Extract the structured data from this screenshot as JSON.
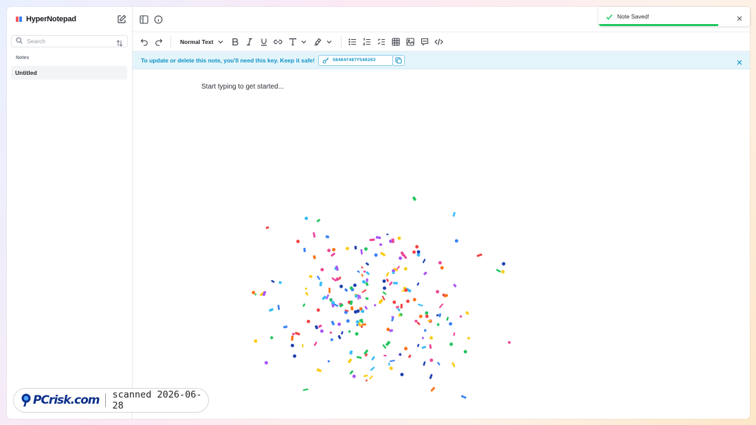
{
  "sidebar": {
    "brand": "HyperNotepad",
    "search_placeholder": "Search",
    "section_label": "Notes",
    "notes": [
      {
        "title": "Untitled"
      }
    ]
  },
  "toolbar": {
    "block_type": "Normal Text"
  },
  "banner": {
    "message": "To update or delete this note, you'll need this key. Keep it safe!",
    "key": "58484f487f548263"
  },
  "editor": {
    "placeholder": "Start typing to get started..."
  },
  "toast": {
    "message": "Note Saved!",
    "progress": 0.79
  },
  "watermark": {
    "brand": "PCrisk.com",
    "scan_text": "scanned 2026-06-28"
  },
  "colors": {
    "accent": "#0d94c6",
    "success": "#22c55e",
    "banner_bg": "#e4f4fb",
    "confetti": [
      "#3b82f6",
      "#38bdf8",
      "#ef4444",
      "#f97316",
      "#facc15",
      "#a855f7",
      "#ec4899",
      "#22c55e",
      "#1e40af"
    ]
  }
}
